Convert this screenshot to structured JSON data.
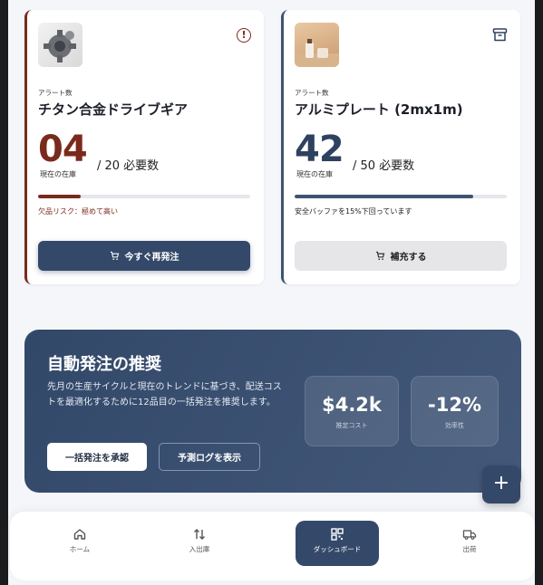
{
  "cards": [
    {
      "alert_label": "アラート数",
      "title": "チタン合金ドライブギア",
      "current": "04",
      "current_label": "現在の在庫",
      "required": "/ 20 必要数",
      "progress": 0.2,
      "note": "欠品リスク：極めて高い",
      "button": "今すぐ再発注",
      "thumb_icon": "gear-image",
      "status_icon": "alert-circle-icon"
    },
    {
      "alert_label": "アラート数",
      "title": "アルミプレート (2mx1m)",
      "current": "42",
      "current_label": "現在の在庫",
      "required": "/ 50 必要数",
      "progress": 0.84,
      "note": "安全バッファを15%下回っています",
      "button": "補充する",
      "thumb_icon": "plate-image",
      "status_icon": "archive-icon"
    }
  ],
  "promo": {
    "title": "自動発注の推奨",
    "description": "先月の生産サイクルと現在のトレンドに基づき、配送コストを最適化するために12品目の一括発注を推奨します。",
    "approve_button": "一括発注を承認",
    "log_button": "予測ログを表示",
    "stats": [
      {
        "value": "$4.2k",
        "label": "推定コスト"
      },
      {
        "value": "-12%",
        "label": "効率性"
      }
    ]
  },
  "fab_label": "+",
  "nav": [
    {
      "label": "ホーム",
      "icon": "home-icon"
    },
    {
      "label": "入出庫",
      "icon": "swap-icon"
    },
    {
      "label": "ダッシュボード",
      "icon": "qr-grid-icon",
      "active": true
    },
    {
      "label": "出荷",
      "icon": "truck-icon"
    }
  ],
  "colors": {
    "critical": "#7a2a1c",
    "primary": "#34496a",
    "background": "#f5f6fa"
  }
}
